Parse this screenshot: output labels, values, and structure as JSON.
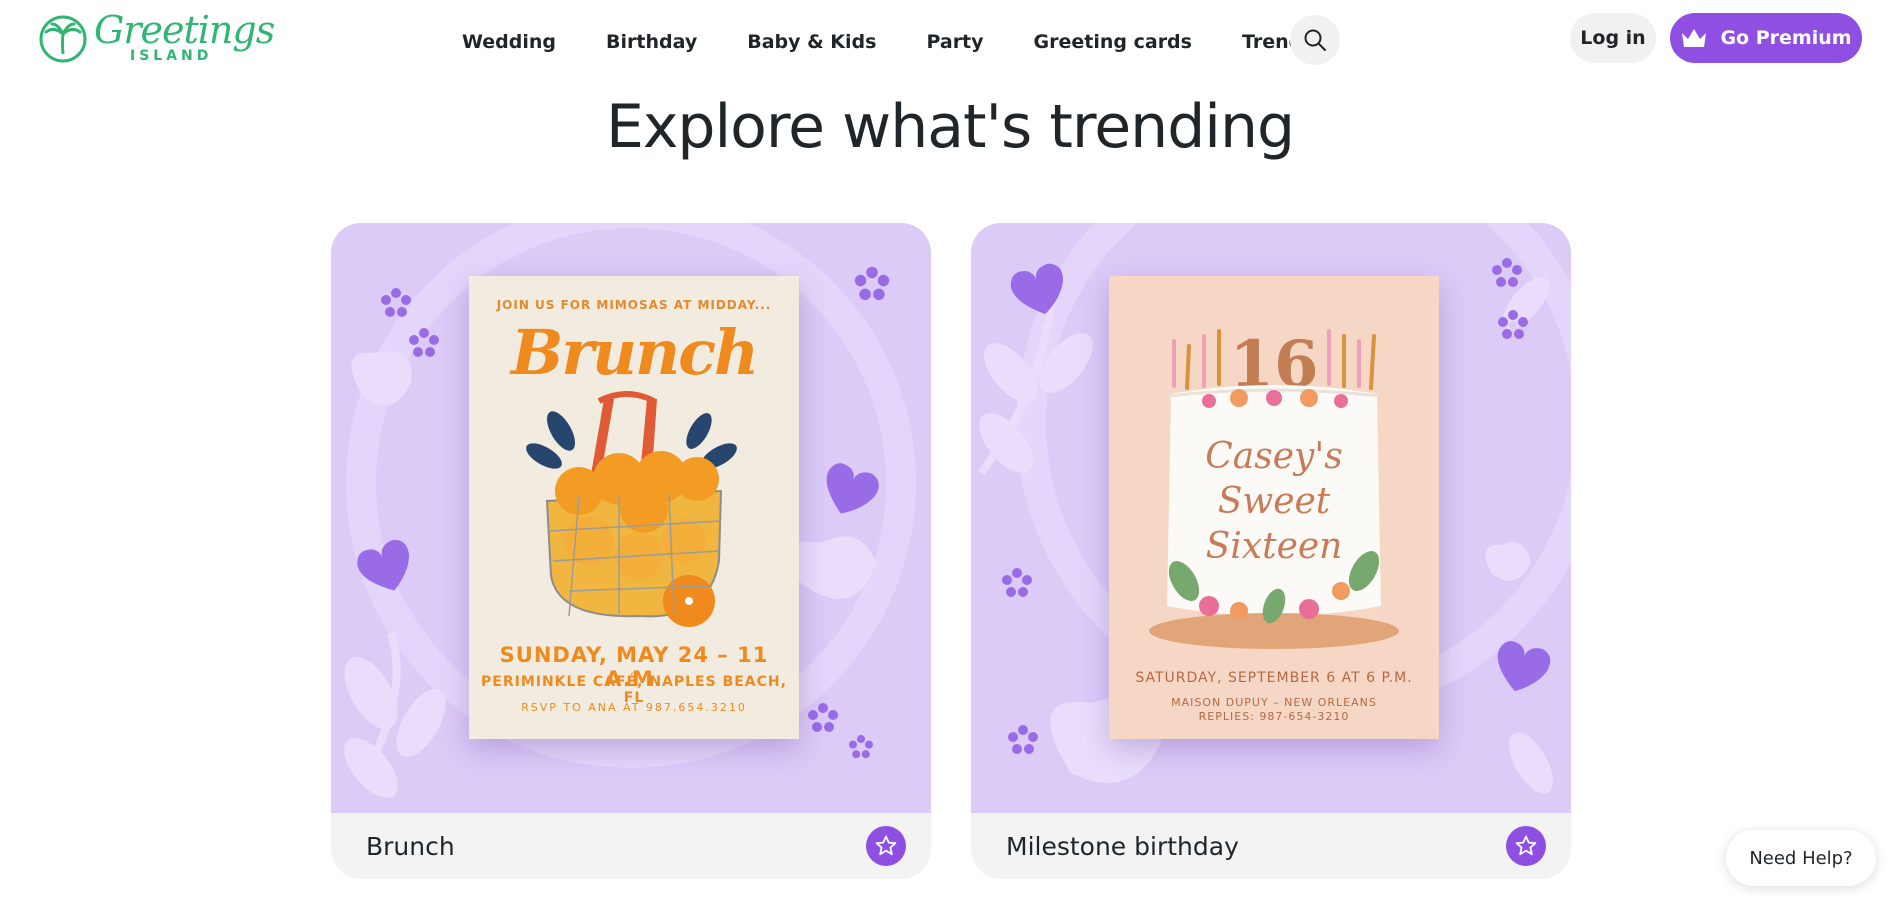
{
  "header": {
    "logo": {
      "brand": "Greetings",
      "sub": "ISLAND"
    },
    "nav": [
      "Wedding",
      "Birthday",
      "Baby & Kids",
      "Party",
      "Greeting cards",
      "Trending"
    ],
    "login_label": "Log in",
    "premium_label": "Go Premium"
  },
  "main": {
    "title": "Explore what's trending",
    "cards": [
      {
        "label": "Brunch",
        "invite": {
          "kicker": "JOIN US FOR MIMOSAS AT MIDDAY...",
          "title": "Brunch",
          "date": "SUNDAY, MAY 24 – 11 A.M.",
          "place": "PERIMINKLE CAFÉ, NAPLES BEACH, FL",
          "rsvp": "RSVP TO ANA AT 987.654.3210"
        }
      },
      {
        "label": "Milestone birthday",
        "invite": {
          "number": "16",
          "name_line1": "Casey's",
          "name_line2": "Sweet",
          "name_line3": "Sixteen",
          "date": "SATURDAY, SEPTEMBER 6 AT 6 P.M.",
          "place": "MAISON DUPUY – NEW ORLEANS",
          "reply": "REPLIES: 987-654-3210"
        }
      }
    ]
  },
  "help": {
    "label": "Need Help?"
  },
  "colors": {
    "accent": "#8f4fe3",
    "brand_green": "#2fb673",
    "card_bg": "#dccaf7"
  },
  "icons": [
    "palm-logo-icon",
    "search-icon",
    "crown-icon",
    "star-icon",
    "flower-icon",
    "heart-icon",
    "leaf-icon",
    "orange-icon",
    "cake-icon",
    "candle-icon"
  ]
}
